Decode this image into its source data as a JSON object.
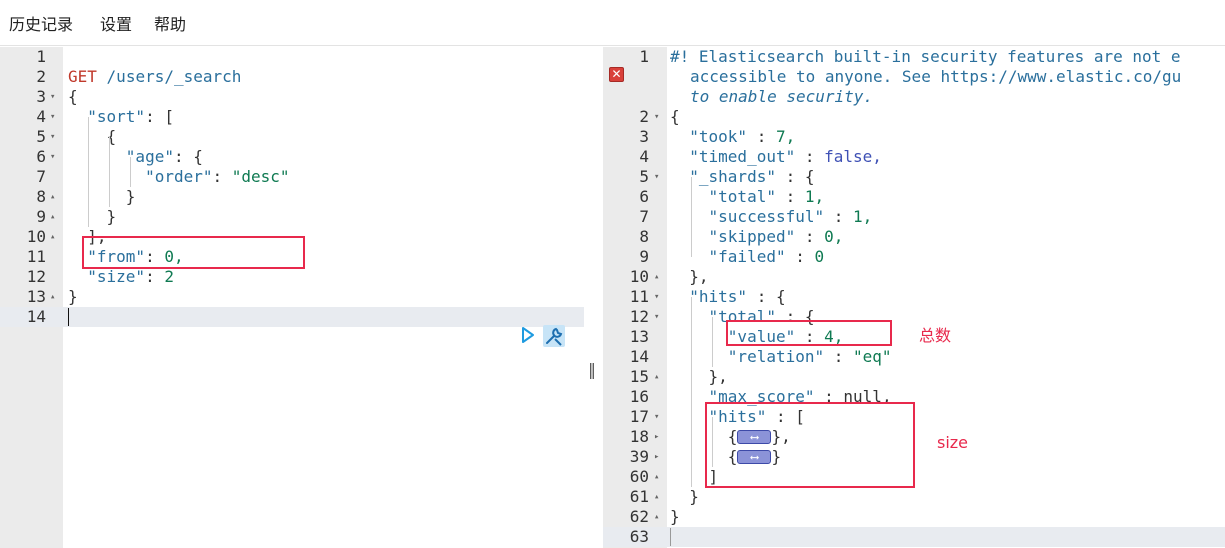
{
  "menu": {
    "history": "历史记录",
    "settings": "设置",
    "help": "帮助"
  },
  "request": {
    "lines": [
      {
        "n": "1",
        "fold": ""
      },
      {
        "n": "2",
        "fold": ""
      },
      {
        "n": "3",
        "fold": "▾"
      },
      {
        "n": "4",
        "fold": "▾"
      },
      {
        "n": "5",
        "fold": "▾"
      },
      {
        "n": "6",
        "fold": "▾"
      },
      {
        "n": "7",
        "fold": ""
      },
      {
        "n": "8",
        "fold": "▴"
      },
      {
        "n": "9",
        "fold": "▴"
      },
      {
        "n": "10",
        "fold": "▴"
      },
      {
        "n": "11",
        "fold": ""
      },
      {
        "n": "12",
        "fold": ""
      },
      {
        "n": "13",
        "fold": "▴"
      },
      {
        "n": "14",
        "fold": ""
      }
    ],
    "method": "GET",
    "url": "/users/_search",
    "open_brace": "{",
    "sort_key": "\"sort\"",
    "colon": ": ",
    "open_bracket": "[",
    "age_key": "\"age\"",
    "order_key": "\"order\"",
    "order_value": "\"desc\"",
    "close_brace": "}",
    "close_bracket_comma": "],",
    "from_key": "\"from\"",
    "from_value": "0,",
    "size_key": "\"size\"",
    "size_value": "2"
  },
  "response": {
    "lines": [
      {
        "n": "1",
        "fold": ""
      },
      {
        "n": "",
        "fold": ""
      },
      {
        "n": "",
        "fold": ""
      },
      {
        "n": "2",
        "fold": "▾"
      },
      {
        "n": "3",
        "fold": ""
      },
      {
        "n": "4",
        "fold": ""
      },
      {
        "n": "5",
        "fold": "▾"
      },
      {
        "n": "6",
        "fold": ""
      },
      {
        "n": "7",
        "fold": ""
      },
      {
        "n": "8",
        "fold": ""
      },
      {
        "n": "9",
        "fold": ""
      },
      {
        "n": "10",
        "fold": "▴"
      },
      {
        "n": "11",
        "fold": "▾"
      },
      {
        "n": "12",
        "fold": "▾"
      },
      {
        "n": "13",
        "fold": ""
      },
      {
        "n": "14",
        "fold": ""
      },
      {
        "n": "15",
        "fold": "▴"
      },
      {
        "n": "16",
        "fold": ""
      },
      {
        "n": "17",
        "fold": "▾"
      },
      {
        "n": "18",
        "fold": "▸"
      },
      {
        "n": "39",
        "fold": "▸"
      },
      {
        "n": "60",
        "fold": "▴"
      },
      {
        "n": "61",
        "fold": "▴"
      },
      {
        "n": "62",
        "fold": "▴"
      },
      {
        "n": "63",
        "fold": ""
      }
    ],
    "warning_1": "#! Elasticsearch built-in security features are not e",
    "warning_2": "accessible to anyone. See https://www.elastic.co/gu",
    "warning_3": "to enable security.",
    "took_key": "\"took\"",
    "took_value": "7,",
    "timed_out_key": "\"timed_out\"",
    "timed_out_value": "false,",
    "shards_key": "\"_shards\"",
    "total_key": "\"total\"",
    "total_value": "1,",
    "successful_key": "\"successful\"",
    "successful_value": "1,",
    "skipped_key": "\"skipped\"",
    "skipped_value": "0,",
    "failed_key": "\"failed\"",
    "failed_value": "0",
    "hits_key": "\"hits\"",
    "value_key": "\"value\"",
    "value_value": "4,",
    "relation_key": "\"relation\"",
    "relation_value": "\"eq\"",
    "max_score_key": "\"max_score\"",
    "max_score_value": "null,",
    "sep": " : ",
    "open_brace": "{",
    "close_brace": "}",
    "close_brace_comma": "},",
    "open_bracket": "[",
    "close_bracket": "]"
  },
  "annotations": {
    "total_label": "总数",
    "size_label": "size"
  },
  "icons": {
    "run": "play-icon",
    "settings": "wrench-icon",
    "error": "error-icon"
  },
  "colors": {
    "highlight": "#e8294c",
    "key": "#2a6f9c",
    "string": "#0f7a52"
  }
}
